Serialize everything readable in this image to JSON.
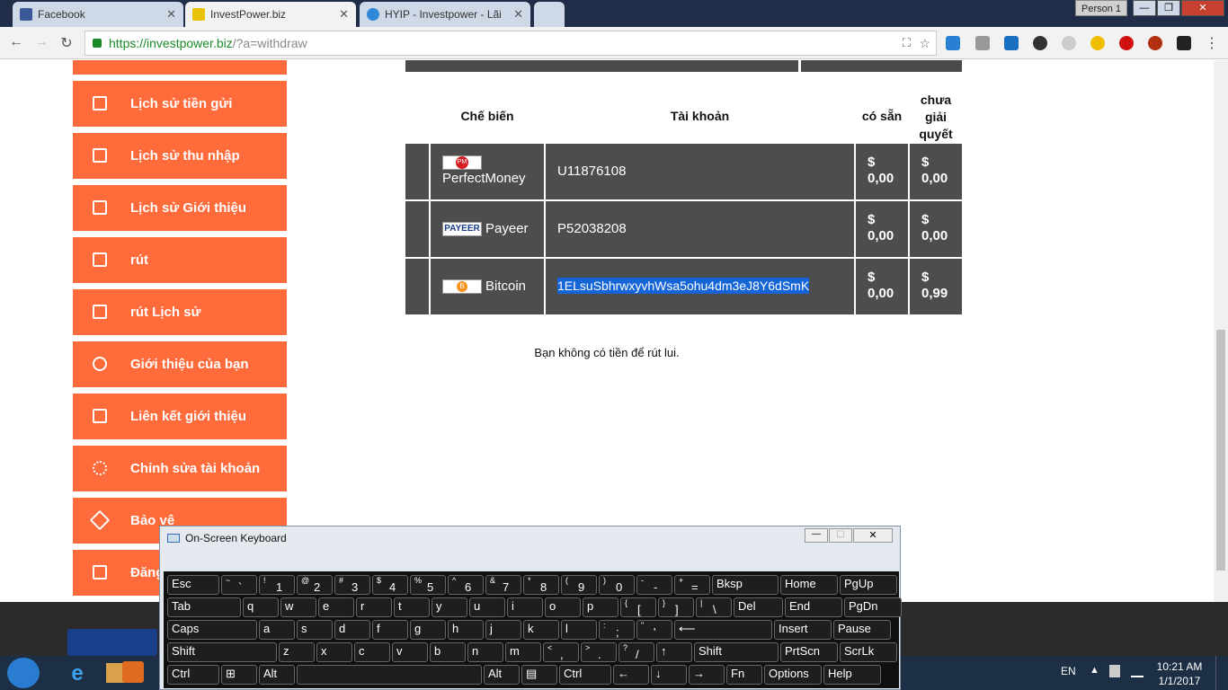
{
  "browser": {
    "tabs": [
      {
        "label": "Facebook",
        "color": "#3b5998"
      },
      {
        "label": "InvestPower.biz",
        "color": "#e8c100"
      },
      {
        "label": "HYIP - Investpower - Lãi",
        "color": "#2e89d8"
      }
    ],
    "person": "Person 1",
    "url_prefix": "https://investpower.biz",
    "url_rest": "/?a=withdraw"
  },
  "sidebar": {
    "items": [
      {
        "label": "Lịch sử tiền gửi"
      },
      {
        "label": "Lịch sử thu nhập"
      },
      {
        "label": "Lịch sử Giới thiệu"
      },
      {
        "label": "rút"
      },
      {
        "label": "rút Lịch sử"
      },
      {
        "label": "Giới thiệu của bạn"
      },
      {
        "label": "Liên kết giới thiệu"
      },
      {
        "label": "Chỉnh sửa tài khoản"
      },
      {
        "label": "Bảo vệ"
      },
      {
        "label": "Đăng"
      }
    ]
  },
  "table": {
    "headers": {
      "processor": "Chế biến",
      "account": "Tài khoản",
      "available": "có sẵn",
      "pending_1": "chưa",
      "pending_2": "giải",
      "pending_3": "quyết"
    },
    "rows": [
      {
        "name": "PerfectMoney",
        "logo": "PM",
        "account": "U11876108",
        "available": "0,00",
        "pending": "0,00",
        "currency": "$"
      },
      {
        "name": "Payeer",
        "logo": "PAYEER",
        "account": "P52038208",
        "available": "0,00",
        "pending": "0,00",
        "currency": "$"
      },
      {
        "name": "Bitcoin",
        "logo": "B",
        "account": "1ELsuSbhrwxyvhWsa5ohu4dm3eJ8Y6dSmK",
        "available": "0,00",
        "pending": "0,99",
        "currency": "$"
      }
    ]
  },
  "message": "Bạn không có tiền để rút lui.",
  "osk": {
    "title": "On-Screen Keyboard",
    "rows": [
      [
        {
          "t": "Esc"
        },
        {
          "s": "~",
          "m": "`"
        },
        {
          "s": "!",
          "m": "1"
        },
        {
          "s": "@",
          "m": "2"
        },
        {
          "s": "#",
          "m": "3"
        },
        {
          "s": "$",
          "m": "4"
        },
        {
          "s": "%",
          "m": "5"
        },
        {
          "s": "^",
          "m": "6"
        },
        {
          "s": "&",
          "m": "7"
        },
        {
          "s": "*",
          "m": "8"
        },
        {
          "s": "(",
          "m": "9"
        },
        {
          "s": ")",
          "m": "0"
        },
        {
          "s": "-",
          "m": "-"
        },
        {
          "s": "+",
          "m": "="
        },
        {
          "t": "Bksp"
        },
        {
          "t": "Home"
        },
        {
          "t": "PgUp"
        }
      ],
      [
        {
          "t": "Tab"
        },
        {
          "t": "q"
        },
        {
          "t": "w"
        },
        {
          "t": "e"
        },
        {
          "t": "r"
        },
        {
          "t": "t"
        },
        {
          "t": "y"
        },
        {
          "t": "u"
        },
        {
          "t": "i"
        },
        {
          "t": "o"
        },
        {
          "t": "p"
        },
        {
          "s": "{",
          "m": "["
        },
        {
          "s": "}",
          "m": "]"
        },
        {
          "s": "|",
          "m": "\\"
        },
        {
          "t": "Del"
        },
        {
          "t": "End"
        },
        {
          "t": "PgDn"
        }
      ],
      [
        {
          "t": "Caps"
        },
        {
          "t": "a"
        },
        {
          "t": "s"
        },
        {
          "t": "d"
        },
        {
          "t": "f"
        },
        {
          "t": "g"
        },
        {
          "t": "h"
        },
        {
          "t": "j"
        },
        {
          "t": "k"
        },
        {
          "t": "l"
        },
        {
          "s": ":",
          "m": ";"
        },
        {
          "s": "\"",
          "m": "'"
        },
        {
          "t": "⟵"
        },
        {
          "t": "Insert"
        },
        {
          "t": "Pause"
        }
      ],
      [
        {
          "t": "Shift"
        },
        {
          "t": "z"
        },
        {
          "t": "x"
        },
        {
          "t": "c"
        },
        {
          "t": "v"
        },
        {
          "t": "b"
        },
        {
          "t": "n"
        },
        {
          "t": "m"
        },
        {
          "s": "<",
          "m": ","
        },
        {
          "s": ">",
          "m": "."
        },
        {
          "s": "?",
          "m": "/"
        },
        {
          "t": "↑"
        },
        {
          "t": "Shift"
        },
        {
          "t": "PrtScn"
        },
        {
          "t": "ScrLk"
        }
      ],
      [
        {
          "t": "Ctrl"
        },
        {
          "t": "⊞"
        },
        {
          "t": "Alt"
        },
        {
          "t": ""
        },
        {
          "t": "Alt"
        },
        {
          "t": "▤"
        },
        {
          "t": "Ctrl"
        },
        {
          "t": "←"
        },
        {
          "t": "↓"
        },
        {
          "t": "→"
        },
        {
          "t": "Fn"
        },
        {
          "t": "Options"
        },
        {
          "t": "Help"
        }
      ]
    ]
  },
  "taskbar": {
    "lang": "EN",
    "time": "10:21 AM",
    "date": "1/1/2017"
  }
}
